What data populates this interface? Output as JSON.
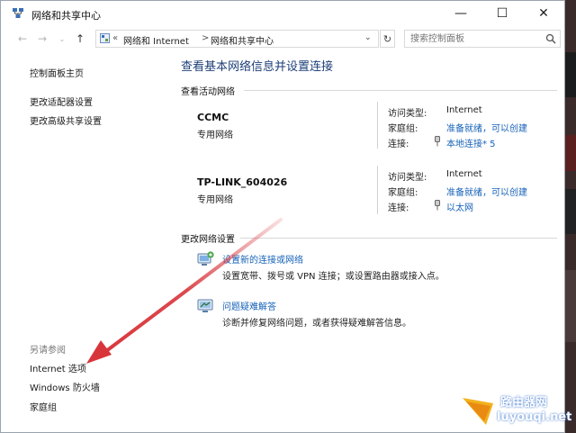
{
  "window": {
    "title": "网络和共享中心",
    "controls": {
      "minimize": "—",
      "maximize": "☐",
      "close": "✕"
    }
  },
  "address_bar": {
    "overflow": "«",
    "crumbs": [
      "网络和 Internet",
      "网络和共享中心"
    ],
    "separator": ">",
    "search_placeholder": "搜索控制面板"
  },
  "sidebar": {
    "items": [
      "控制面板主页",
      "更改适配器设置",
      "更改高级共享设置"
    ],
    "see_also_heading": "另请参阅",
    "see_also": [
      "Internet 选项",
      "Windows 防火墙",
      "家庭组"
    ]
  },
  "main": {
    "title": "查看基本网络信息并设置连接",
    "active_networks_heading": "查看活动网络",
    "networks": [
      {
        "name": "CCMC",
        "type": "专用网络",
        "access_label": "访问类型:",
        "access_value": "Internet",
        "homegroup_label": "家庭组:",
        "homegroup_value": "准备就绪，可以创建",
        "connection_label": "连接:",
        "connection_value": "本地连接* 5"
      },
      {
        "name": "TP-LINK_604026",
        "type": "专用网络",
        "access_label": "访问类型:",
        "access_value": "Internet",
        "homegroup_label": "家庭组:",
        "homegroup_value": "准备就绪，可以创建",
        "connection_label": "连接:",
        "connection_value": "以太网"
      }
    ],
    "change_settings_heading": "更改网络设置",
    "tasks": [
      {
        "link": "设置新的连接或网络",
        "desc": "设置宽带、拨号或 VPN 连接；或设置路由器或接入点。"
      },
      {
        "link": "问题疑难解答",
        "desc": "诊断并修复网络问题，或者获得疑难解答信息。"
      }
    ]
  },
  "watermark": {
    "line1": "路由器网",
    "line2": "luyouqi.net"
  },
  "colors": {
    "link": "#1662b8",
    "title": "#1e3f78",
    "arrow": "#d8353b"
  }
}
